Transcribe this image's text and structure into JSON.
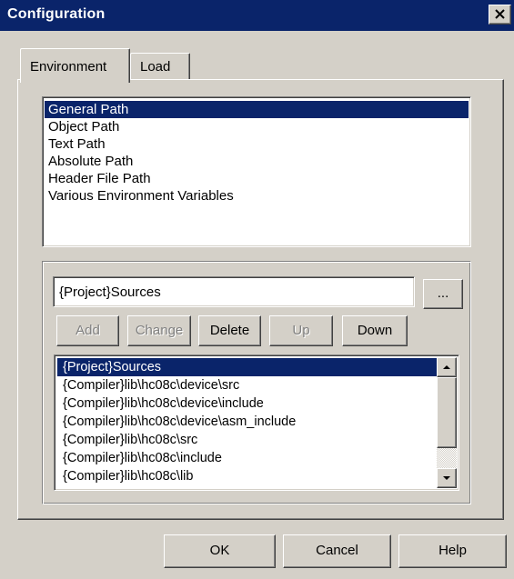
{
  "window": {
    "title": "Configuration"
  },
  "tabs": [
    {
      "label": "Environment",
      "active": true
    },
    {
      "label": "Load",
      "active": false
    }
  ],
  "path_types": [
    "General Path",
    "Object Path",
    "Text Path",
    "Absolute Path",
    "Header File Path",
    "Various Environment Variables"
  ],
  "path_types_selected": "General Path",
  "path_input": {
    "value": "{Project}Sources"
  },
  "browse_label": "...",
  "action_buttons": {
    "add": "Add",
    "change": "Change",
    "delete": "Delete",
    "up": "Up",
    "down": "Down"
  },
  "source_paths": [
    "{Project}Sources",
    "{Compiler}lib\\hc08c\\device\\src",
    "{Compiler}lib\\hc08c\\device\\include",
    "{Compiler}lib\\hc08c\\device\\asm_include",
    "{Compiler}lib\\hc08c\\src",
    "{Compiler}lib\\hc08c\\include",
    "{Compiler}lib\\hc08c\\lib"
  ],
  "source_paths_selected": "{Project}Sources",
  "dialog_buttons": {
    "ok": "OK",
    "cancel": "Cancel",
    "help": "Help"
  },
  "colors": {
    "face": "#d4d0c8",
    "title_bar": "#0a246a",
    "selection": "#0a246a",
    "disabled_text": "#808080"
  },
  "icons": {
    "close": "close-icon",
    "scroll_up": "scroll-up-arrow-icon",
    "scroll_down": "scroll-down-arrow-icon"
  }
}
